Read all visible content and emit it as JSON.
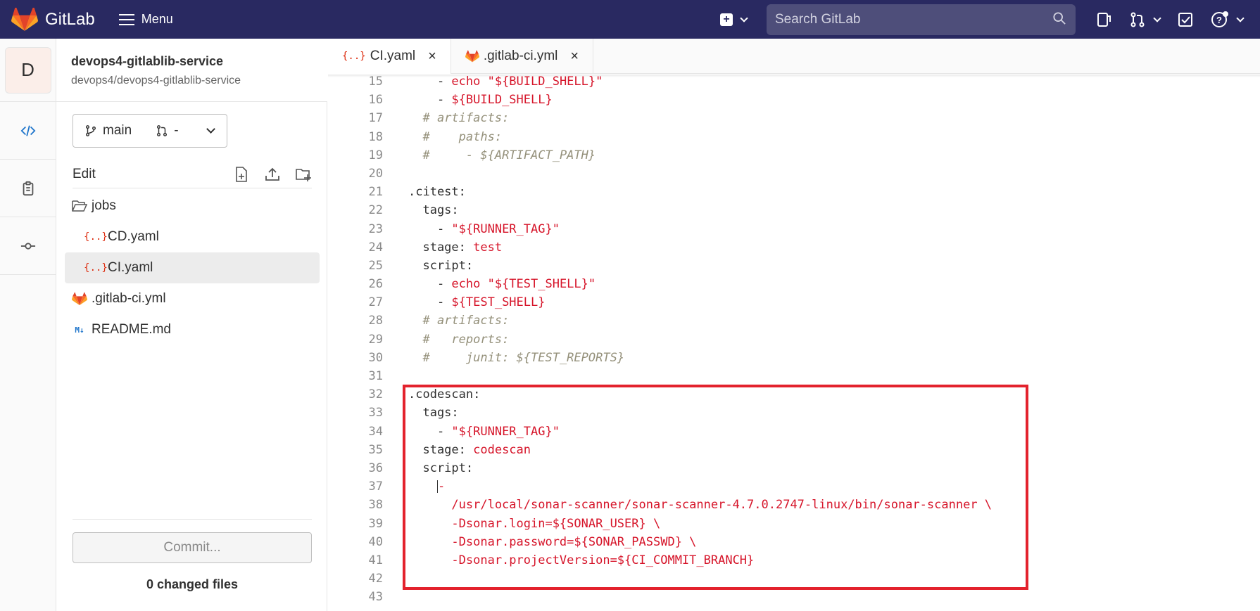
{
  "topbar": {
    "logo_text": "GitLab",
    "menu_label": "Menu",
    "search_placeholder": "Search GitLab",
    "colors": {
      "bg": "#292961",
      "search_bg": "#4e4e7a"
    }
  },
  "project": {
    "avatar_letter": "D",
    "name": "devops4-gitlablib-service",
    "path": "devops4/devops4-gitlablib-service"
  },
  "branch": {
    "name": "main",
    "mr": "-"
  },
  "file_panel": {
    "edit_label": "Edit",
    "tree": [
      {
        "name": "jobs",
        "type": "folder"
      },
      {
        "name": "CD.yaml",
        "type": "yaml"
      },
      {
        "name": "CI.yaml",
        "type": "yaml"
      },
      {
        "name": ".gitlab-ci.yml",
        "type": "gitlab"
      },
      {
        "name": "README.md",
        "type": "markdown"
      }
    ],
    "commit_label": "Commit...",
    "changed_files": "0 changed files"
  },
  "tabs": [
    {
      "label": "CI.yaml",
      "icon": "yaml-icon"
    },
    {
      "label": ".gitlab-ci.yml",
      "icon": "gitlab-icon"
    }
  ],
  "editor": {
    "lines": [
      {
        "n": "15",
        "t": "    - echo \"${BUILD_SHELL}\""
      },
      {
        "n": "16",
        "t": "    - ${BUILD_SHELL}"
      },
      {
        "n": "17",
        "t": "  # artifacts:"
      },
      {
        "n": "18",
        "t": "  #    paths:"
      },
      {
        "n": "19",
        "t": "  #     - ${ARTIFACT_PATH}"
      },
      {
        "n": "20",
        "t": ""
      },
      {
        "n": "21",
        "t": ".citest:"
      },
      {
        "n": "22",
        "t": "  tags:"
      },
      {
        "n": "23",
        "t": "    - \"${RUNNER_TAG}\""
      },
      {
        "n": "24",
        "t": "  stage: test"
      },
      {
        "n": "25",
        "t": "  script:"
      },
      {
        "n": "26",
        "t": "    - echo \"${TEST_SHELL}\""
      },
      {
        "n": "27",
        "t": "    - ${TEST_SHELL}"
      },
      {
        "n": "28",
        "t": "  # artifacts:"
      },
      {
        "n": "29",
        "t": "  #   reports:"
      },
      {
        "n": "30",
        "t": "  #     junit: ${TEST_REPORTS}"
      },
      {
        "n": "31",
        "t": ""
      },
      {
        "n": "32",
        "t": ".codescan:"
      },
      {
        "n": "33",
        "t": "  tags:"
      },
      {
        "n": "34",
        "t": "    - \"${RUNNER_TAG}\""
      },
      {
        "n": "35",
        "t": "  stage: codescan"
      },
      {
        "n": "36",
        "t": "  script:"
      },
      {
        "n": "37",
        "t": "    |-"
      },
      {
        "n": "38",
        "t": "      /usr/local/sonar-scanner/sonar-scanner-4.7.0.2747-linux/bin/sonar-scanner \\"
      },
      {
        "n": "39",
        "t": "      -Dsonar.login=${SONAR_USER} \\"
      },
      {
        "n": "40",
        "t": "      -Dsonar.password=${SONAR_PASSWD} \\"
      },
      {
        "n": "41",
        "t": "      -Dsonar.projectVersion=${CI_COMMIT_BRANCH}"
      },
      {
        "n": "42",
        "t": ""
      },
      {
        "n": "43",
        "t": ""
      }
    ],
    "highlight_color": "#e3222d"
  }
}
